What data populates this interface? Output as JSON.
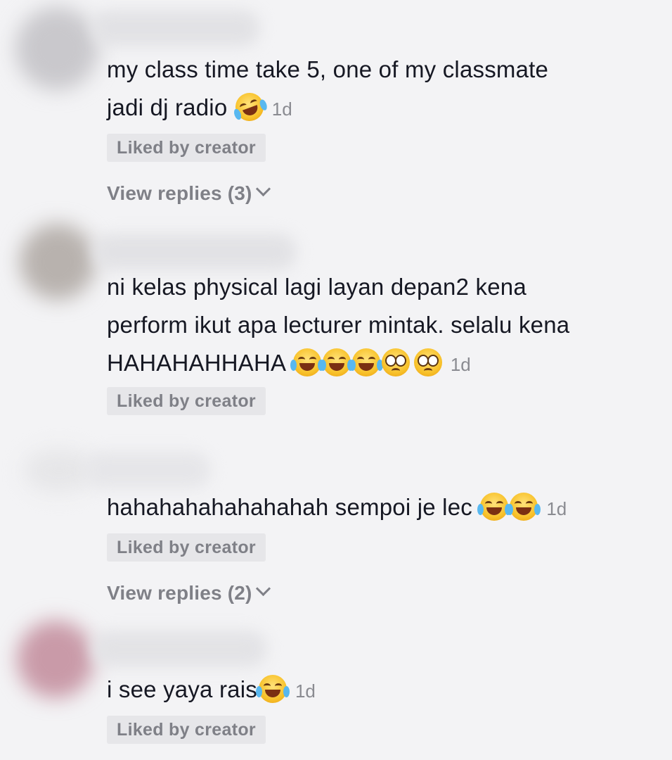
{
  "comments": [
    {
      "text": "my class time take 5, one of my classmate",
      "text2": "jadi dj radio",
      "time": "1d",
      "badge": "Liked by creator",
      "replies": "View replies (3)"
    },
    {
      "text": "ni kelas physical lagi layan depan2 kena",
      "text2": "perform ikut apa lecturer mintak. selalu kena",
      "text3": "HAHAHAHHAHA",
      "time": "1d",
      "badge": "Liked by creator"
    },
    {
      "text": "hahahahahahahahah sempoi je lec",
      "time": "1d",
      "badge": "Liked by creator",
      "replies": "View replies (2)"
    },
    {
      "text": "i see yaya rais",
      "time": "1d",
      "badge": "Liked by creator"
    }
  ],
  "colors": {
    "background": "#f3f3f5",
    "text": "#161823",
    "muted": "#8a8b91",
    "badge_bg": "#e6e6e9"
  },
  "icons": [
    "rolling-on-floor-laughing-emoji",
    "tears-of-joy-emoji",
    "pleading-face-emoji",
    "chevron-down-icon"
  ]
}
